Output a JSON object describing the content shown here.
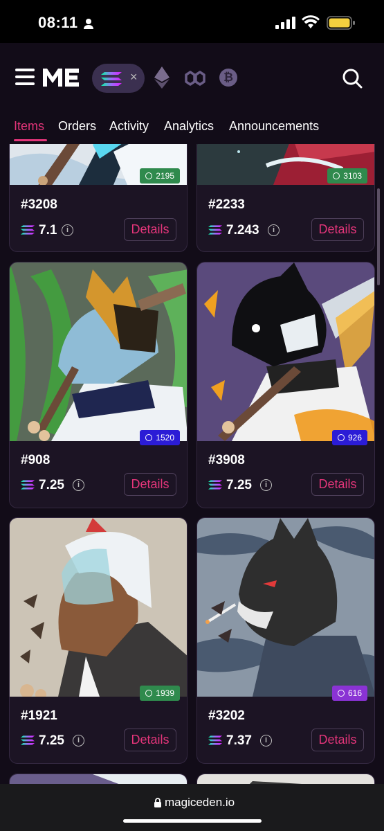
{
  "status_bar": {
    "time": "08:11"
  },
  "header": {
    "logo": "Magic Eden logo",
    "chain_selected": "solana",
    "chain_pill_close": "×",
    "chains": [
      "ethereum",
      "polygon",
      "bitcoin"
    ],
    "btc_glyph": "₿"
  },
  "tabs": [
    {
      "label": "Items",
      "active": true
    },
    {
      "label": "Orders",
      "active": false
    },
    {
      "label": "Activity",
      "active": false
    },
    {
      "label": "Analytics",
      "active": false
    },
    {
      "label": "Announcements",
      "active": false
    }
  ],
  "details_label": "Details",
  "info_glyph": "i",
  "cards": [
    {
      "name": "#3208",
      "price": "7.1",
      "rank": "2195",
      "rank_color": "#2f8a4d"
    },
    {
      "name": "#2233",
      "price": "7.243",
      "rank": "3103",
      "rank_color": "#2f8a4d"
    },
    {
      "name": "#908",
      "price": "7.25",
      "rank": "1520",
      "rank_color": "#2b1cd6"
    },
    {
      "name": "#3908",
      "price": "7.25",
      "rank": "926",
      "rank_color": "#2b1cd6"
    },
    {
      "name": "#1921",
      "price": "7.25",
      "rank": "1939",
      "rank_color": "#2f8a4d"
    },
    {
      "name": "#3202",
      "price": "7.37",
      "rank": "616",
      "rank_color": "#8a33d4"
    }
  ],
  "url": "magiceden.io",
  "colors": {
    "accent": "#e4357a",
    "background": "#120c18",
    "card": "#1c1424"
  }
}
